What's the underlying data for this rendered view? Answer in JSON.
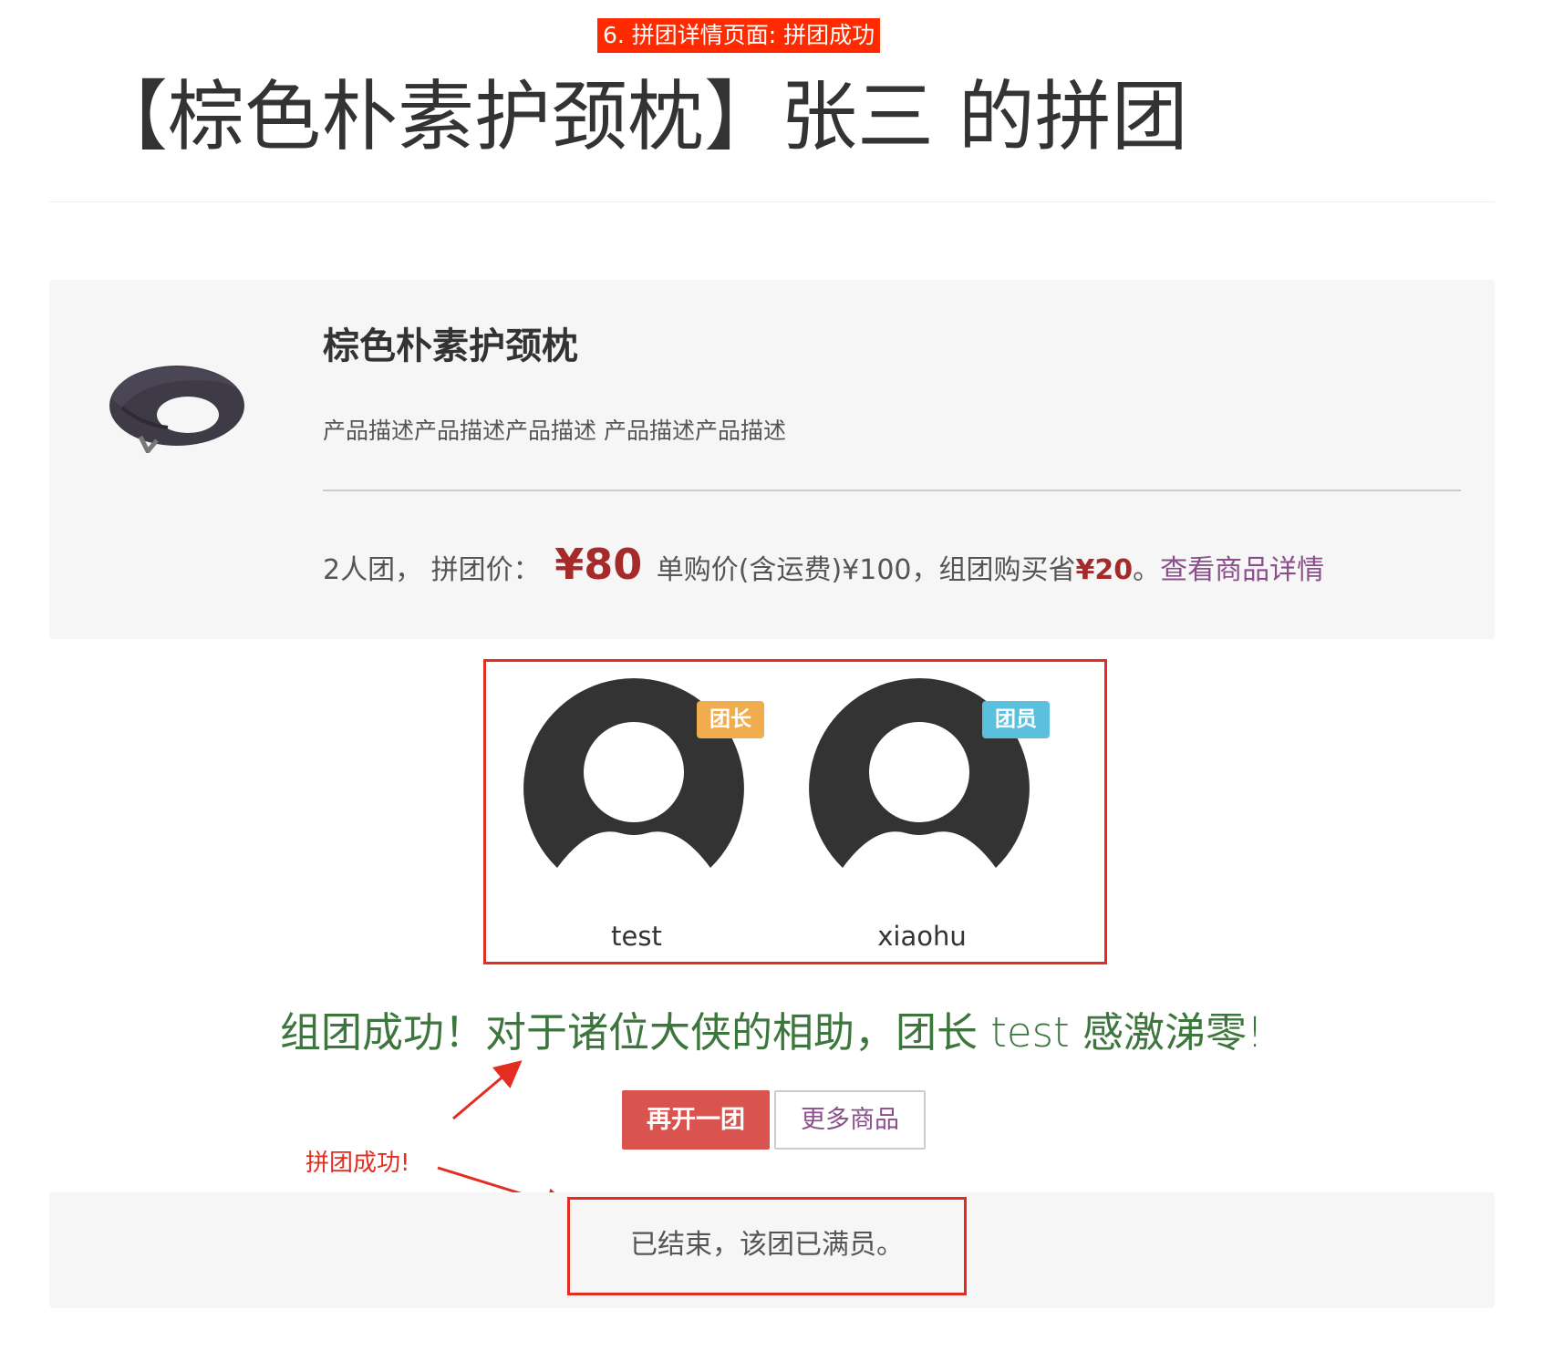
{
  "annotation": {
    "step_label": "6. 拼团详情页面: 拼团成功",
    "arrow_note": "拼团成功!"
  },
  "page": {
    "title": "【棕色朴素护颈枕】张三 的拼团"
  },
  "product": {
    "name": "棕色朴素护颈枕",
    "description": "产品描述产品描述产品描述 产品描述产品描述",
    "group_size_text": "2人团，",
    "group_price_label": "拼团价：",
    "group_price": "¥80",
    "single_price_text": "单购价(含运费)¥100，组团购买省",
    "saving": "¥20",
    "saving_suffix": "。",
    "detail_link": "查看商品详情"
  },
  "members": [
    {
      "name": "test",
      "role": "团长",
      "role_color": "#f0ad4e"
    },
    {
      "name": "xiaohu",
      "role": "团员",
      "role_color": "#5bc0de"
    }
  ],
  "success_message": "组团成功！对于诸位大侠的相助，团长 test 感激涕零!",
  "buttons": {
    "reopen": "再开一团",
    "more_products": "更多商品"
  },
  "status": {
    "text": "已结束，该团已满员。"
  },
  "colors": {
    "annotation_red": "#e32d21",
    "price_red": "#a72a2a",
    "success_green": "#3c763d",
    "link_purple": "#8a4f8a",
    "primary_button": "#d9534f"
  }
}
